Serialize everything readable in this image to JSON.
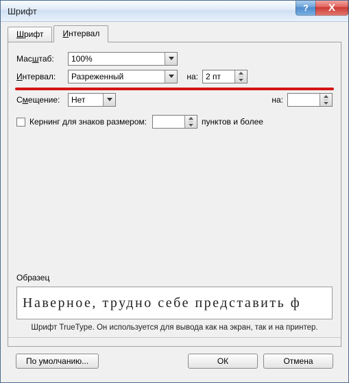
{
  "window": {
    "title": "Шрифт"
  },
  "titlebar": {
    "help_symbol": "?",
    "close_symbol": "X"
  },
  "tabs": [
    {
      "label_pre": "",
      "label_u": "Ш",
      "label_post": "рифт"
    },
    {
      "label_pre": "",
      "label_u": "И",
      "label_post": "нтервал"
    }
  ],
  "form": {
    "scale": {
      "label_pre": "Мас",
      "label_u": "ш",
      "label_post": "таб:",
      "value": "100%"
    },
    "spacing": {
      "label_pre": "",
      "label_u": "И",
      "label_post": "нтервал:",
      "value": "Разреженный",
      "by_label_pre": "",
      "by_label_u": "на",
      "by_label_post": ":",
      "by_value": "2 пт"
    },
    "position": {
      "label_pre": "С",
      "label_u": "м",
      "label_post": "ещение:",
      "value": "Нет",
      "by_label": "на:",
      "by_value": ""
    },
    "kerning": {
      "label_pre": "",
      "label_u": "К",
      "label_post": "ернинг для знаков размером:",
      "value": "",
      "suffix": "пунктов и более"
    }
  },
  "sample": {
    "label": "Образец",
    "text": "Наверное, трудно себе представить ф",
    "description": "Шрифт TrueType. Он используется для вывода как на экран, так и на принтер."
  },
  "buttons": {
    "default": "По умолчанию...",
    "ok": "ОК",
    "cancel": "Отмена"
  }
}
